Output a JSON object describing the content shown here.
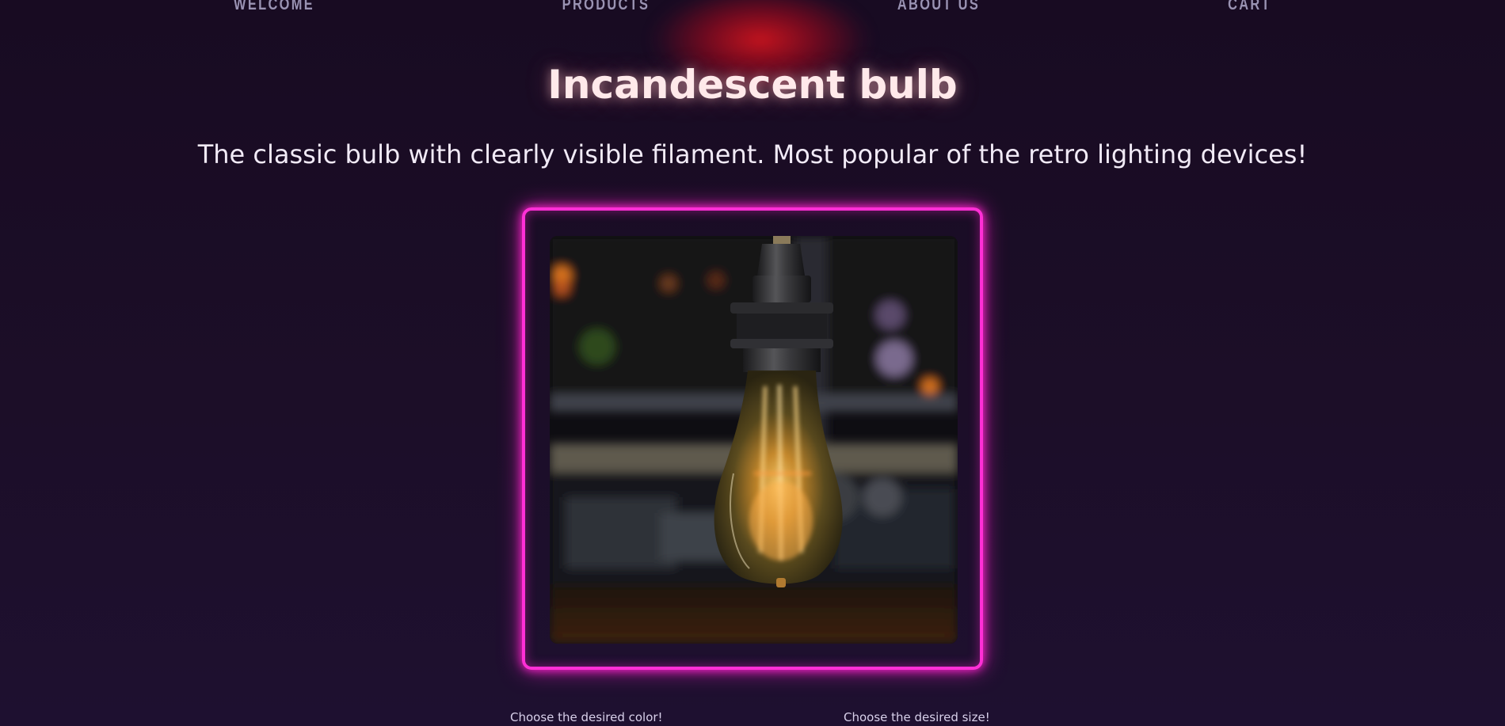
{
  "nav": {
    "items": [
      "WELCOME",
      "PRODUCTS",
      "ABOUT US",
      "CART"
    ]
  },
  "product": {
    "title": "Incandescent bulb",
    "description": "The classic bulb with clearly visible filament. Most popular of the retro lighting devices!"
  },
  "options": {
    "color_label": "Choose the desired color!",
    "size_label": "Choose the desired size!"
  },
  "colors": {
    "background": "#1a0d24",
    "frame_neon": "#ff2fd6",
    "title_glow": "#ff8fa0",
    "nav_text": "#9a93b3",
    "accent_red": "#cd141e"
  }
}
